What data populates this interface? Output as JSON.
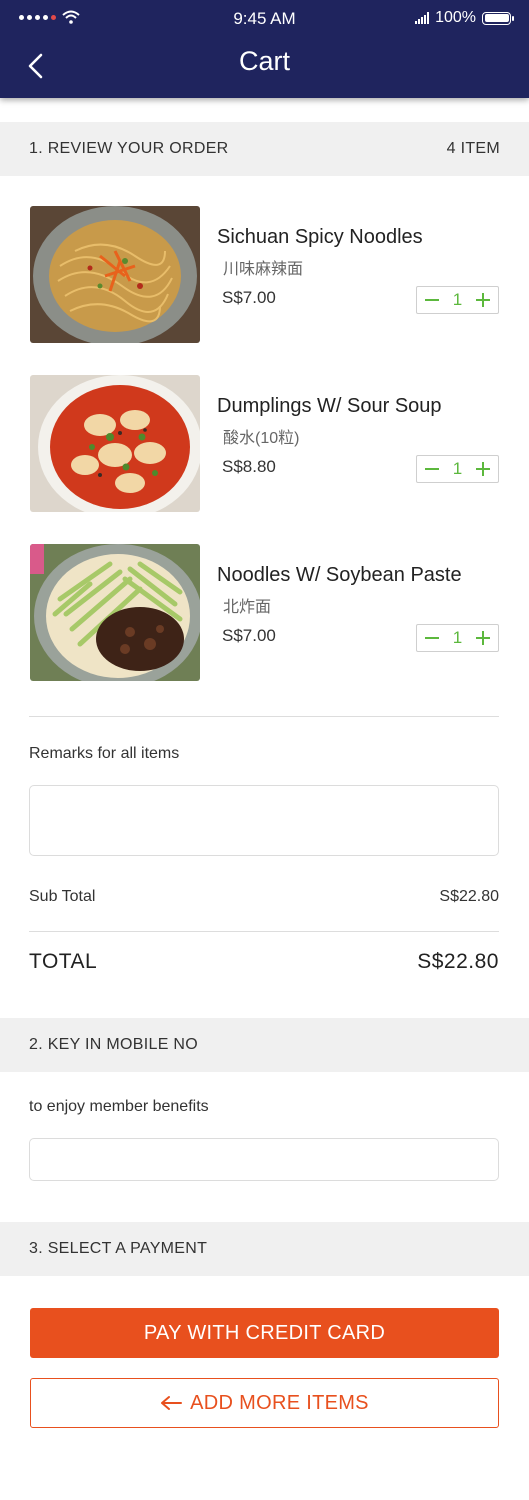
{
  "status_bar": {
    "time": "9:45 AM",
    "battery": "100%"
  },
  "header": {
    "title": "Cart",
    "back_icon": "chevron-left-icon",
    "background": "#1f245e"
  },
  "sections": {
    "review": {
      "title": "1. REVIEW YOUR ORDER",
      "count": "4 ITEM"
    },
    "mobile": {
      "title": "2. KEY IN MOBILE NO"
    },
    "payment": {
      "title": "3. SELECT A PAYMENT"
    }
  },
  "items": [
    {
      "name": "Sichuan Spicy Noodles",
      "chinese": "川味麻辣面",
      "price": "S$7.00",
      "qty": "1",
      "image": "noodles-with-chili-and-carrot"
    },
    {
      "name": "Dumplings W/ Sour Soup",
      "chinese": "酸水(10粒)",
      "price": "S$8.80",
      "qty": "1",
      "image": "dumplings-in-red-soup"
    },
    {
      "name": "Noodles W/ Soybean Paste",
      "chinese": "北炸面",
      "price": "S$7.00",
      "qty": "1",
      "image": "noodles-with-cucumber-and-soybean-paste"
    }
  ],
  "remarks": {
    "label": "Remarks for all items",
    "value": "",
    "placeholder": ""
  },
  "totals": {
    "subtotal_label": "Sub Total",
    "subtotal_value": "S$22.80",
    "total_label": "TOTAL",
    "total_value": "S$22.80"
  },
  "mobile": {
    "label": "to enjoy member benefits",
    "value": "",
    "placeholder": ""
  },
  "buttons": {
    "pay": "PAY WITH CREDIT CARD",
    "add_more": "ADD MORE ITEMS",
    "add_more_icon": "arrow-left-icon"
  },
  "colors": {
    "accent": "#e8501e",
    "stepper": "#5cb83d",
    "section_bg": "#f0f0f0"
  }
}
